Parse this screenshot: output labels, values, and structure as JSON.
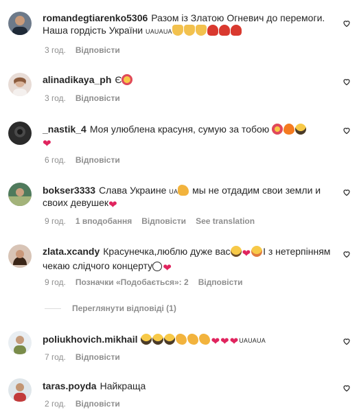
{
  "comments": [
    {
      "username": "romandegtiarenko5306",
      "text": "Разом із Златою Огневич до перемоги. Наша гордість України",
      "flag_text": "UAUAUA",
      "emojis": [
        "pray-emoji",
        "pray-emoji",
        "pray-emoji",
        "rose-emoji",
        "rose-emoji",
        "rose-emoji"
      ],
      "time": "3 год.",
      "reply": "Відповісти"
    },
    {
      "username": "alinadikaya_ph",
      "text": "Є",
      "emojis": [
        "star-eyes-emoji"
      ],
      "time": "3 год.",
      "reply": "Відповісти"
    },
    {
      "username": "_nastik_4",
      "text": "Моя улюблена красуня, сумую за тобою",
      "emojis": [
        "heart-eyes-emoji",
        "fire-emoji",
        "scream-emoji",
        "heart-emoji"
      ],
      "time": "6 год.",
      "reply": "Відповісти"
    },
    {
      "username": "bokser3333",
      "text": "Слава Украине",
      "flag_text": "UA",
      "text2": "мы не отдадим свои земли и своих девушек",
      "emojis": [
        "muscle-emoji",
        "heart-emoji"
      ],
      "time": "9 год.",
      "likes": "1 вподобання",
      "reply": "Відповісти",
      "translation": "See translation"
    },
    {
      "username": "zlata.xcandy",
      "text": "Красунечка,люблю дуже вас",
      "text2": "І з нетерпінням чекаю слідчого концерту",
      "emojis": [
        "sad-emoji",
        "heart-emoji",
        "hug-emoji",
        "smile-emoji",
        "heart-emoji"
      ],
      "time": "9 год.",
      "likes": "Позначки «Подобається»: 2",
      "reply": "Відповісти",
      "view_replies": "Переглянути відповіді (1)"
    },
    {
      "username": "poliukhovich.mikhail",
      "text": "",
      "flag_text": "UAUAUA",
      "emojis": [
        "scream-emoji",
        "scream-emoji",
        "scream-emoji",
        "clap-emoji",
        "clap-emoji",
        "clap-emoji",
        "heart-emoji",
        "heart-emoji",
        "heart-emoji"
      ],
      "time": "7 год.",
      "reply": "Відповісти"
    },
    {
      "username": "taras.poyda",
      "text": "Найкраща",
      "time": "2 год.",
      "reply": "Відповісти"
    }
  ],
  "colors": {
    "text": "#262626",
    "meta": "#8e8e8e",
    "heart": "#e0245e"
  }
}
